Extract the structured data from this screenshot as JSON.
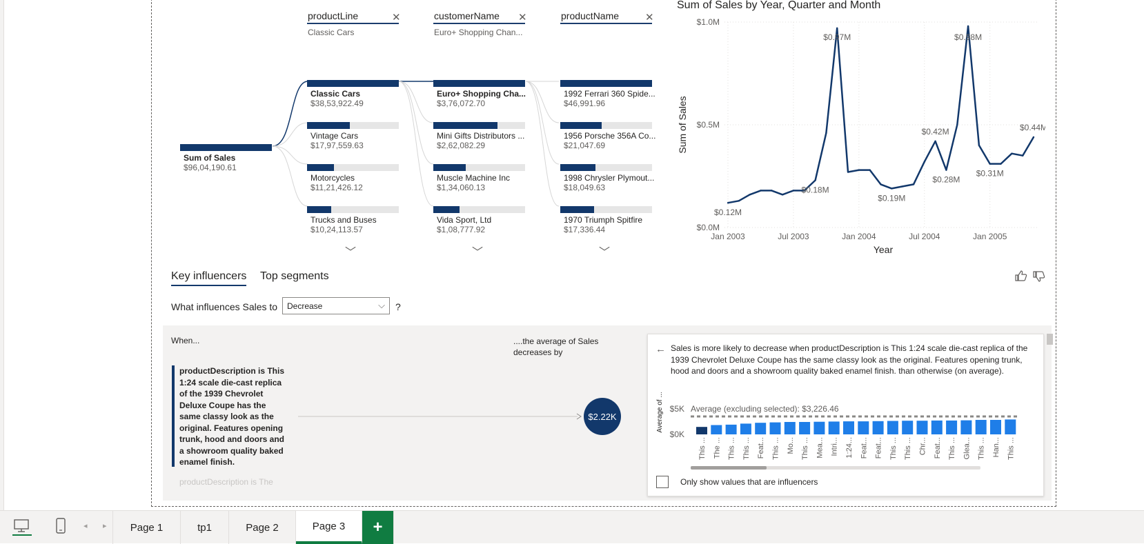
{
  "decomp": {
    "levels": [
      {
        "field": "productLine",
        "selected": "Classic Cars"
      },
      {
        "field": "customerName",
        "selected": "Euro+ Shopping Chan..."
      },
      {
        "field": "productName",
        "selected": ""
      }
    ],
    "root": {
      "name": "Sum of Sales",
      "value": "$96,04,190.61"
    },
    "col1": [
      {
        "name": "Classic Cars",
        "value": "$38,53,922.49",
        "fraction": 1.0
      },
      {
        "name": "Vintage Cars",
        "value": "$17,97,559.63",
        "fraction": 0.466
      },
      {
        "name": "Motorcycles",
        "value": "$11,21,426.12",
        "fraction": 0.291
      },
      {
        "name": "Trucks and Buses",
        "value": "$10,24,113.57",
        "fraction": 0.266
      }
    ],
    "col2": [
      {
        "name": "Euro+ Shopping Cha...",
        "value": "$3,76,072.70",
        "fraction": 1.0
      },
      {
        "name": "Mini Gifts Distributors ...",
        "value": "$2,62,082.29",
        "fraction": 0.697
      },
      {
        "name": "Muscle Machine Inc",
        "value": "$1,34,060.13",
        "fraction": 0.356
      },
      {
        "name": "Vida Sport, Ltd",
        "value": "$1,08,777.92",
        "fraction": 0.289
      }
    ],
    "col3": [
      {
        "name": "1992 Ferrari 360 Spide...",
        "value": "$46,991.96",
        "fraction": 1.0
      },
      {
        "name": "1956 Porsche 356A Co...",
        "value": "$21,047.69",
        "fraction": 0.448
      },
      {
        "name": "1998 Chrysler Plymout...",
        "value": "$18,049.63",
        "fraction": 0.384
      },
      {
        "name": "1970 Triumph Spitfire",
        "value": "$17,336.44",
        "fraction": 0.369
      }
    ]
  },
  "chart_data": {
    "type": "line",
    "title": "Sum of Sales by Year, Quarter and Month",
    "xlabel": "Year",
    "ylabel": "Sum of Sales",
    "y_ticks": [
      "$0.0M",
      "$0.5M",
      "$1.0M"
    ],
    "x_ticks": [
      "Jan 2003",
      "Jul 2003",
      "Jan 2004",
      "Jul 2004",
      "Jan 2005"
    ],
    "ylim": [
      0,
      1.0
    ],
    "grid": true,
    "series": [
      {
        "values": [
          0.12,
          0.13,
          0.16,
          0.18,
          0.18,
          0.16,
          0.18,
          0.18,
          0.23,
          0.46,
          0.97,
          0.27,
          0.28,
          0.28,
          0.21,
          0.19,
          0.2,
          0.21,
          0.32,
          0.42,
          0.28,
          0.5,
          0.98,
          0.4,
          0.31,
          0.31,
          0.36,
          0.35,
          0.44
        ]
      }
    ],
    "data_labels": [
      {
        "index": 0,
        "text": "$0.12M",
        "pos": "below"
      },
      {
        "index": 10,
        "text": "$0.97M",
        "pos": "above"
      },
      {
        "index": 8,
        "text": "$0.18M",
        "pos": "below"
      },
      {
        "index": 15,
        "text": "$0.19M",
        "pos": "below"
      },
      {
        "index": 19,
        "text": "$0.42M",
        "pos": "above"
      },
      {
        "index": 20,
        "text": "$0.28M",
        "pos": "below"
      },
      {
        "index": 22,
        "text": "$0.98M",
        "pos": "above"
      },
      {
        "index": 24,
        "text": "$0.31M",
        "pos": "below"
      },
      {
        "index": 28,
        "text": "$0.44M",
        "pos": "above"
      }
    ]
  },
  "ki": {
    "tabs": [
      "Key influencers",
      "Top segments"
    ],
    "question_prefix": "What influences Sales to",
    "question_value": "Decrease",
    "question_suffix": "?",
    "when": "When...",
    "avg_header": "....the average of Sales decreases by",
    "influencer_text": "productDescription is This 1:24 scale die-cast replica of the 1939 Chevrolet Deluxe Coupe has the same classy look as the original. Features opening trunk, hood and doors and a showroom quality baked enamel finish.",
    "next_influencer": "productDescription is The",
    "circle_value": "$2.22K",
    "detail_text": "Sales is more likely to decrease when productDescription is This 1:24 scale die-cast replica of the 1939 Chevrolet Deluxe Coupe has the same classy look as the original. Features opening trunk, hood and doors and a showroom quality baked enamel finish. than otherwise (on average).",
    "detail_ylabel": "Average of ...",
    "detail_yticks": [
      "$5K",
      "$0K"
    ],
    "avg_label": "Average (excluding selected): $3,226.46",
    "detail_bars_x": [
      "This ...",
      "The ...",
      "This ...",
      "This ...",
      "Feat...",
      "This ...",
      "Mo...",
      "This ...",
      "Mea...",
      "Intri...",
      "1:24...",
      "Feat...",
      "Feat...",
      "This ...",
      "This ...",
      "Chr...",
      "Feat...",
      "This ...",
      "Glea...",
      "This ...",
      "Han...",
      "This ..."
    ],
    "detail_bars": [
      0.36,
      0.45,
      0.47,
      0.52,
      0.56,
      0.58,
      0.6,
      0.6,
      0.61,
      0.62,
      0.63,
      0.63,
      0.64,
      0.65,
      0.66,
      0.66,
      0.67,
      0.67,
      0.68,
      0.7,
      0.7,
      0.72
    ],
    "checkbox_label": "Only show values that are influencers"
  },
  "tabs": {
    "pages": [
      "Page 1",
      "tp1",
      "Page 2",
      "Page 3"
    ],
    "active": "Page 3",
    "add": "+"
  },
  "colors": {
    "navy": "#12386b",
    "bright_bar": "#1f7ee8",
    "tab_green": "#107c41"
  }
}
